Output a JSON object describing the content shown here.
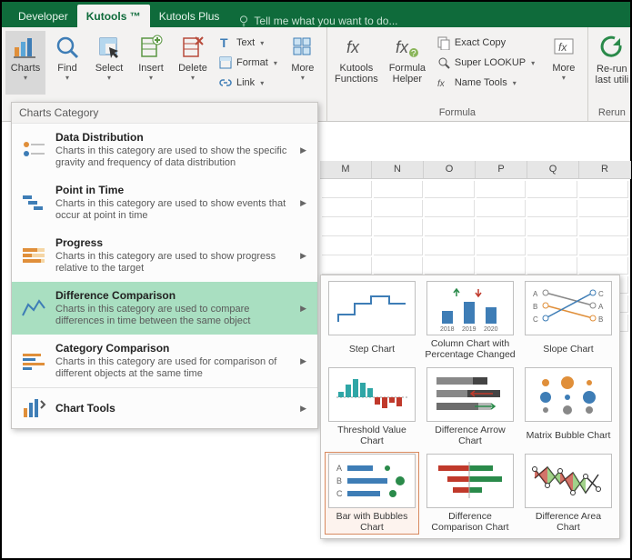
{
  "tabs": {
    "developer": "Developer",
    "kutools": "Kutools ™",
    "kutools_plus": "Kutools Plus"
  },
  "tell_me": "Tell me what you want to do...",
  "ribbon": {
    "charts": "Charts",
    "find": "Find",
    "select": "Select",
    "insert": "Insert",
    "delete": "Delete",
    "text": "Text",
    "format": "Format",
    "link": "Link",
    "more": "More",
    "kutools_functions": "Kutools\nFunctions",
    "formula_helper": "Formula\nHelper",
    "exact_copy": "Exact Copy",
    "super_lookup": "Super LOOKUP",
    "name_tools": "Name Tools",
    "more2": "More",
    "formula_group": "Formula",
    "rerun": "Re-run\nlast utili",
    "rerun_group": "Rerun"
  },
  "dropdown": {
    "title": "Charts Category",
    "items": [
      {
        "title": "Data Distribution",
        "desc": "Charts in this category are used to show the specific gravity and frequency of data distribution"
      },
      {
        "title": "Point in Time",
        "desc": "Charts in this category are used to show events that occur at point in time"
      },
      {
        "title": "Progress",
        "desc": "Charts in this category are used to show progress relative to the target"
      },
      {
        "title": "Difference Comparison",
        "desc": "Charts in this category are used to compare differences in time between the same object"
      },
      {
        "title": "Category Comparison",
        "desc": "Charts in this category are used for comparison of different objects at the same time"
      },
      {
        "title": "Chart Tools",
        "desc": ""
      }
    ]
  },
  "gallery": [
    "Step Chart",
    "Column Chart with Percentage Changed",
    "Slope Chart",
    "Threshold Value Chart",
    "Difference Arrow Chart",
    "Matrix Bubble Chart",
    "Bar with Bubbles Chart",
    "Difference Comparison Chart",
    "Difference Area Chart"
  ],
  "columns": [
    "M",
    "N",
    "O",
    "P",
    "Q",
    "R"
  ]
}
